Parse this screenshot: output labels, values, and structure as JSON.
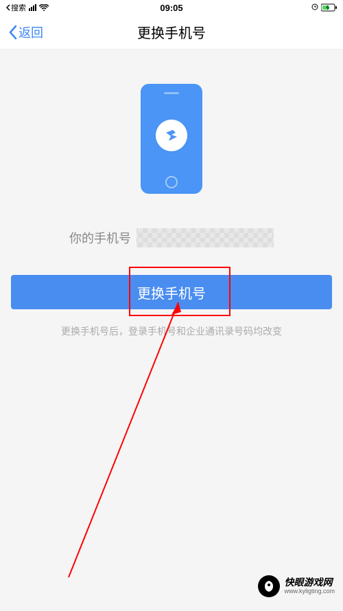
{
  "status": {
    "backApp": "搜索",
    "time": "09:05"
  },
  "nav": {
    "back": "返回",
    "title": "更换手机号"
  },
  "main": {
    "phoneLabel": "你的手机号",
    "changeButton": "更换手机号",
    "hint": "更换手机号后，登录手机号和企业通讯录号码均改变"
  },
  "watermark": {
    "title": "快眼游戏网",
    "url": "www.kyligting.com"
  }
}
